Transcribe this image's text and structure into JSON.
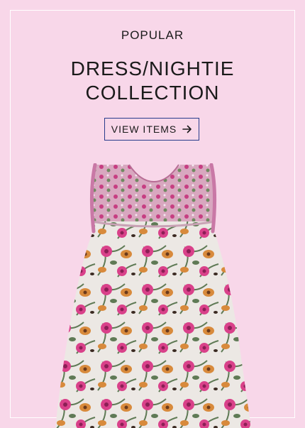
{
  "promo": {
    "eyebrow": "POPULAR",
    "title_line1": "DRESS/NIGHTIE",
    "title_line2": "COLLECTION",
    "cta_label": "VIEW ITEMS",
    "cta_icon": "arrow-right-icon"
  },
  "colors": {
    "background": "#f8d7e9",
    "frame": "#ffffff",
    "button_border": "#283c8c",
    "text": "#1a1a1a",
    "print_pink": "#d9418a",
    "print_orange": "#d88a3c",
    "print_green": "#5f7a55"
  }
}
